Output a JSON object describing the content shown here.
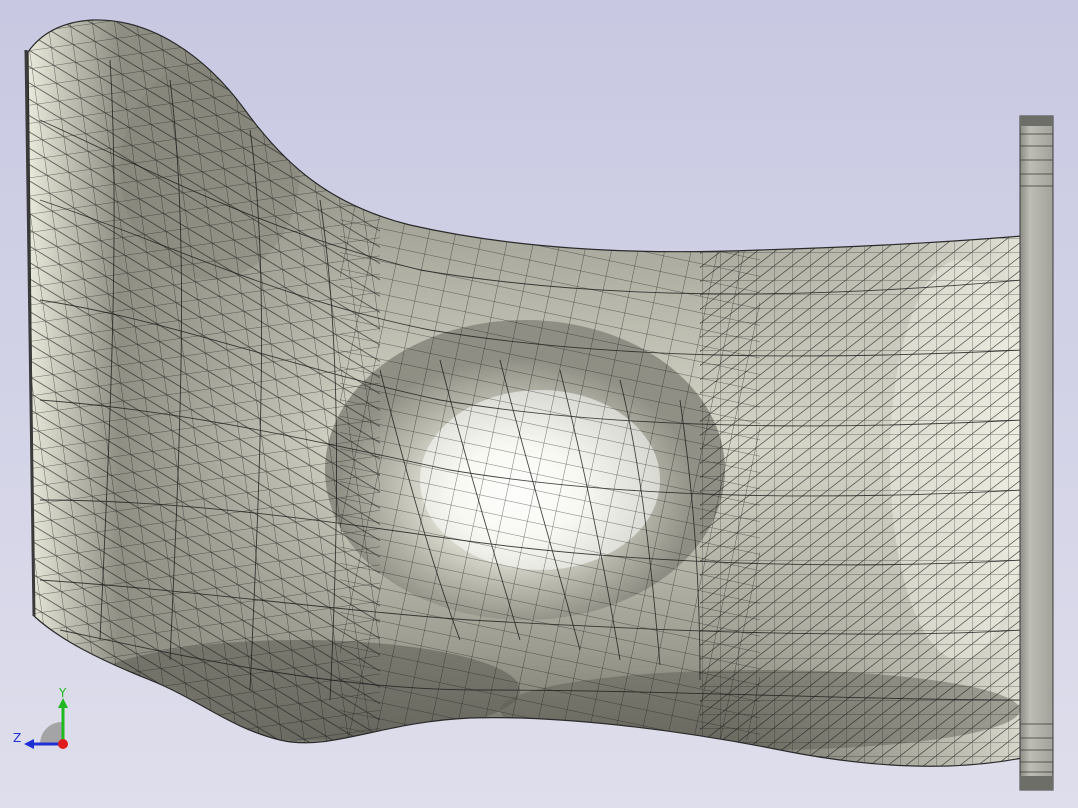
{
  "viewport": {
    "background_top": "#c9c9e3",
    "background_bottom": "#dcdcea",
    "mesh_line_color": "#1a1a1a",
    "surface_light": "#fbfbf1",
    "surface_mid": "#b3b3a6",
    "surface_dark": "#5e5e55",
    "flange_color": "#a8a8a0"
  },
  "triad": {
    "y_label": "Y",
    "z_label": "Z",
    "y_color": "#22b822",
    "z_color": "#1f2fd6",
    "x_color": "#e01c1c"
  }
}
